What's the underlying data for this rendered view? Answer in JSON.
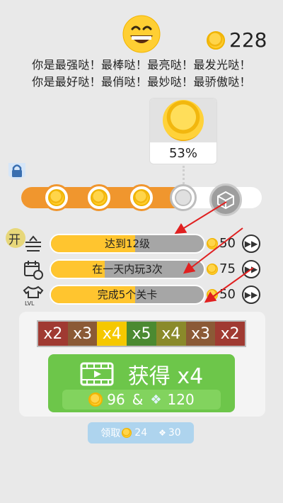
{
  "header": {
    "coin_total": "228",
    "praise_line1": "你是最强哒！最棒哒！最亮哒！最发光哒！",
    "praise_line2": "你是最好哒！最俏哒！最妙哒！最骄傲哒！"
  },
  "progress": {
    "percent_label": "53%",
    "percent": 0.53
  },
  "tasks": [
    {
      "label": "达到12级",
      "reward": "50",
      "progress": 0.55
    },
    {
      "label": "在一天内玩3次",
      "reward": "75",
      "progress": 0.35
    },
    {
      "label": "完成5个关卡",
      "reward": "50",
      "progress": 0.55
    }
  ],
  "task_badge": "开",
  "multipliers": [
    {
      "label": "x2",
      "color": "#a03a32"
    },
    {
      "label": "x3",
      "color": "#8b5a36"
    },
    {
      "label": "x4",
      "color": "#f5c800"
    },
    {
      "label": "x5",
      "color": "#4b8a31"
    },
    {
      "label": "x4",
      "color": "#8a8a2a"
    },
    {
      "label": "x3",
      "color": "#8b5a36"
    },
    {
      "label": "x2",
      "color": "#a03a32"
    }
  ],
  "get_button": {
    "title": "获得 x4",
    "coins": "96",
    "amp": "&",
    "gems": "120"
  },
  "claim": {
    "label": "领取",
    "coins": "24",
    "gems": "30"
  },
  "colors": {
    "accent_orange": "#f0962e",
    "green": "#6dc64a",
    "coin": "#ffc52f"
  }
}
